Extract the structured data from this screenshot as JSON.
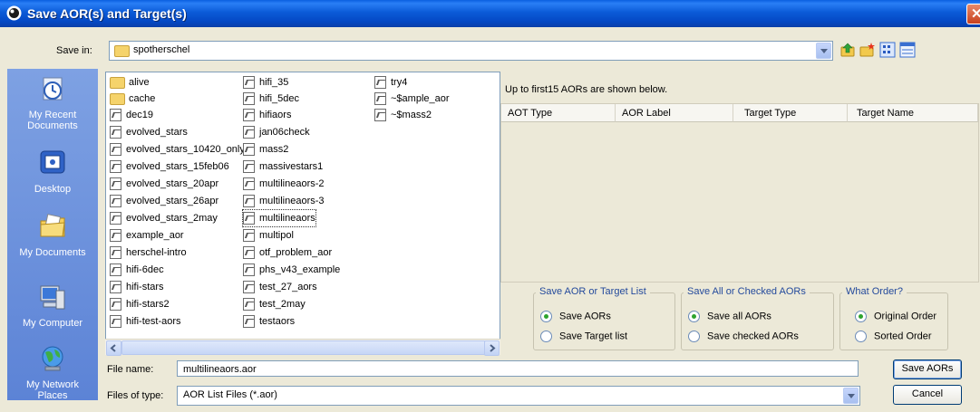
{
  "window": {
    "title": "Save AOR(s) and Target(s)"
  },
  "toolbar": {
    "save_in_label": "Save in:",
    "save_in_value": "spotherschel"
  },
  "places": [
    {
      "label": "My Recent Documents"
    },
    {
      "label": "Desktop"
    },
    {
      "label": "My Documents"
    },
    {
      "label": "My Computer"
    },
    {
      "label": "My Network Places"
    }
  ],
  "files": {
    "col1": [
      "alive",
      "cache",
      "dec19",
      "evolved_stars",
      "evolved_stars_10420_only",
      "evolved_stars_15feb06",
      "evolved_stars_20apr",
      "evolved_stars_26apr",
      "evolved_stars_2may",
      "example_aor",
      "herschel-intro",
      "hifi-6dec",
      "hifi-stars",
      "hifi-stars2",
      "hifi-test-aors"
    ],
    "col2": [
      "hifi_35",
      "hifi_5dec",
      "hifiaors",
      "jan06check",
      "mass2",
      "massivestars1",
      "multilineaors-2",
      "multilineaors-3",
      "multilineaors",
      "multipol",
      "otf_problem_aor",
      "phs_v43_example",
      "test_27_aors",
      "test_2may",
      "testaors"
    ],
    "col3": [
      "try4",
      "~$ample_aor",
      "~$mass2"
    ]
  },
  "preview": {
    "note": "Up to first15 AORs are shown below.",
    "columns": [
      "AOT Type",
      "AOR Label",
      "Target Type",
      "Target Name"
    ]
  },
  "options": {
    "list_group": {
      "title": "Save AOR or Target List",
      "opt1": "Save AORs",
      "opt2": "Save Target list"
    },
    "scope_group": {
      "title": "Save All or Checked AORs",
      "opt1": "Save all AORs",
      "opt2": "Save checked AORs"
    },
    "order_group": {
      "title": "What Order?",
      "opt1": "Original Order",
      "opt2": "Sorted Order"
    }
  },
  "footer": {
    "file_name_label": "File name:",
    "file_name_value": "multilineaors.aor",
    "file_type_label": "Files of type:",
    "file_type_value": "AOR List Files (*.aor)",
    "save_button": "Save AORs",
    "cancel_button": "Cancel"
  },
  "colors": {
    "titlebar": "#0b5bd8",
    "places_panel": "#6b90dc",
    "group_title": "#244a9c"
  }
}
